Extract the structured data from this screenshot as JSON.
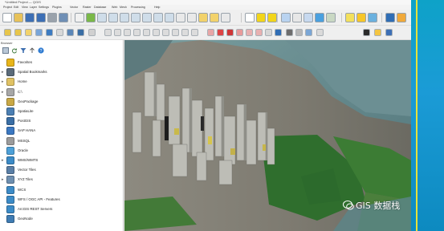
{
  "window": {
    "title": "*Untitled Project — QGIS"
  },
  "menu": [
    "Project",
    "Edit",
    "View",
    "Layer",
    "Settings",
    "Plugins",
    "Vector",
    "Raster",
    "Database",
    "Web",
    "Mesh",
    "Processing",
    "Help"
  ],
  "browser": {
    "title": "Browser",
    "items": [
      {
        "label": "Favorites",
        "icon": "star-icon",
        "color": "#e8b51a",
        "expand": ""
      },
      {
        "label": "Spatial Bookmarks",
        "icon": "bookmark-icon",
        "color": "#5b6b7a",
        "expand": "▸"
      },
      {
        "label": "Home",
        "icon": "folder-icon",
        "color": "#e0c264",
        "expand": "▸"
      },
      {
        "label": "C:\\",
        "icon": "drive-icon",
        "color": "#a7a7a7",
        "expand": "▸"
      },
      {
        "label": "GeoPackage",
        "icon": "geopackage-icon",
        "color": "#c9a845",
        "expand": ""
      },
      {
        "label": "SpatiaLite",
        "icon": "spatialite-icon",
        "color": "#4b7fb3",
        "expand": ""
      },
      {
        "label": "PostGIS",
        "icon": "postgis-icon",
        "color": "#3a6ea5",
        "expand": ""
      },
      {
        "label": "SAP HANA",
        "icon": "database-icon",
        "color": "#3b78c2",
        "expand": ""
      },
      {
        "label": "MSSQL",
        "icon": "mssql-icon",
        "color": "#9b9b9b",
        "expand": ""
      },
      {
        "label": "Oracle",
        "icon": "oracle-icon",
        "color": "#4da0d8",
        "expand": ""
      },
      {
        "label": "WMS/WMTS",
        "icon": "globe-icon",
        "color": "#3c8bc7",
        "expand": "▸"
      },
      {
        "label": "Vector Tiles",
        "icon": "grid-icon",
        "color": "#5a7fa6",
        "expand": ""
      },
      {
        "label": "XYZ Tiles",
        "icon": "grid-icon",
        "color": "#6e8fb0",
        "expand": "▸"
      },
      {
        "label": "WCS",
        "icon": "globe-icon",
        "color": "#3c8bc7",
        "expand": ""
      },
      {
        "label": "WFS / OGC API - Features",
        "icon": "globe-icon",
        "color": "#3c8bc7",
        "expand": ""
      },
      {
        "label": "ArcGIS REST Servers",
        "icon": "globe-icon",
        "color": "#3c8bc7",
        "expand": ""
      },
      {
        "label": "GeoNode",
        "icon": "geonode-icon",
        "color": "#3f7cb3",
        "expand": ""
      }
    ]
  },
  "map": {
    "watermark": "GIS 数据栈"
  }
}
